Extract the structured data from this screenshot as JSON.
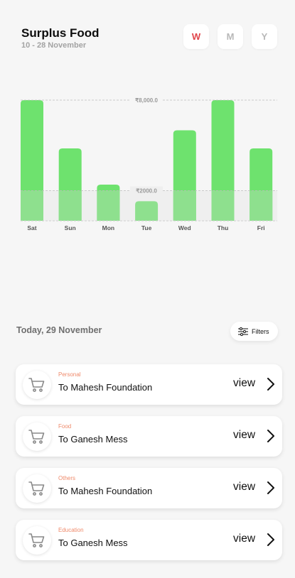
{
  "header": {
    "title": "Surplus Food",
    "date_range": "10 - 28 November"
  },
  "period_tabs": [
    {
      "label": "W",
      "active": true
    },
    {
      "label": "M",
      "active": false
    },
    {
      "label": "Y",
      "active": false
    }
  ],
  "colors": {
    "bar": "#8ee08e",
    "bar_top": "#6ee26e",
    "active_tab": "#e0444a",
    "category": "#ef8a6b"
  },
  "chart_data": {
    "type": "bar",
    "categories": [
      "Sat",
      "Sun",
      "Mon",
      "Tue",
      "Wed",
      "Thu",
      "Fri"
    ],
    "values": [
      8000,
      4800,
      2400,
      1300,
      6000,
      8000,
      4800
    ],
    "reference_lines": [
      {
        "value": 8000,
        "label": "₹8,000.0"
      },
      {
        "value": 2000,
        "label": "₹2000.0"
      }
    ],
    "ylim": [
      0,
      8000
    ],
    "grid": false
  },
  "list": {
    "date_heading": "Today, 29 November",
    "filters_label": "Filters",
    "items": [
      {
        "category": "Personal",
        "name": "To Mahesh Foundation",
        "action": "view",
        "icon": "cart-icon"
      },
      {
        "category": "Food",
        "name": "To Ganesh Mess",
        "action": "view",
        "icon": "cart-icon"
      },
      {
        "category": "Others",
        "name": "To Mahesh Foundation",
        "action": "view",
        "icon": "cart-icon"
      },
      {
        "category": "Education",
        "name": "To Ganesh Mess",
        "action": "view",
        "icon": "cart-icon"
      }
    ]
  }
}
